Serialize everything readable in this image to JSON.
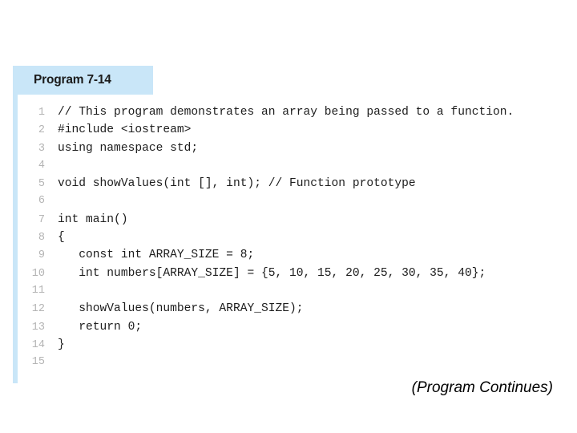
{
  "figure": {
    "header": {
      "title": "Program 7-14"
    },
    "accent_color": "#c9e6f8",
    "code_lines": [
      {
        "number": "1",
        "text": "// This program demonstrates an array being passed to a function."
      },
      {
        "number": "2",
        "text": "#include <iostream>"
      },
      {
        "number": "3",
        "text": "using namespace std;"
      },
      {
        "number": "4",
        "text": ""
      },
      {
        "number": "5",
        "text": "void showValues(int [], int); // Function prototype"
      },
      {
        "number": "6",
        "text": ""
      },
      {
        "number": "7",
        "text": "int main()"
      },
      {
        "number": "8",
        "text": "{"
      },
      {
        "number": "9",
        "text": "   const int ARRAY_SIZE = 8;"
      },
      {
        "number": "10",
        "text": "   int numbers[ARRAY_SIZE] = {5, 10, 15, 20, 25, 30, 35, 40};"
      },
      {
        "number": "11",
        "text": ""
      },
      {
        "number": "12",
        "text": "   showValues(numbers, ARRAY_SIZE);"
      },
      {
        "number": "13",
        "text": "   return 0;"
      },
      {
        "number": "14",
        "text": "}"
      },
      {
        "number": "15",
        "text": ""
      }
    ]
  },
  "caption": {
    "text": "(Program Continues)"
  }
}
